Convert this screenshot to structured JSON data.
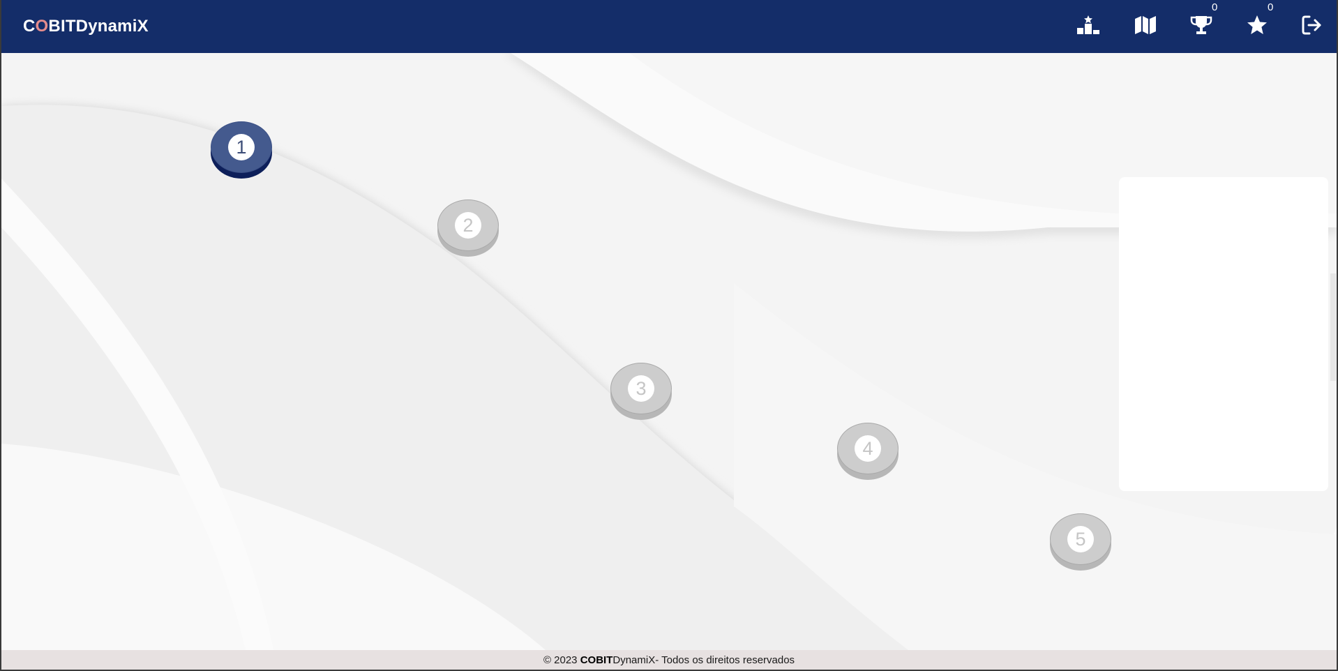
{
  "brand": {
    "first": "C",
    "accent": "O",
    "rest": "BITDynamiX"
  },
  "nav": {
    "icons": [
      "ranking-podium-icon",
      "map-icon",
      "trophy-icon",
      "star-icon",
      "logout-icon"
    ],
    "trophies_count": "0",
    "stars_count": "0"
  },
  "levels": [
    "1",
    "2",
    "3",
    "4",
    "5"
  ],
  "footer": {
    "copyright": "© 2023 ",
    "brand": "COBIT",
    "brand_rest": "DynamiX",
    "text": " - Todos os direitos reservados"
  },
  "colors": {
    "navbar": "#142d69",
    "brand_accent": "#e58c8c",
    "level_active": "#445a8e",
    "level_locked": "#cdcdcd",
    "footer_bg": "#e7e1e1"
  }
}
